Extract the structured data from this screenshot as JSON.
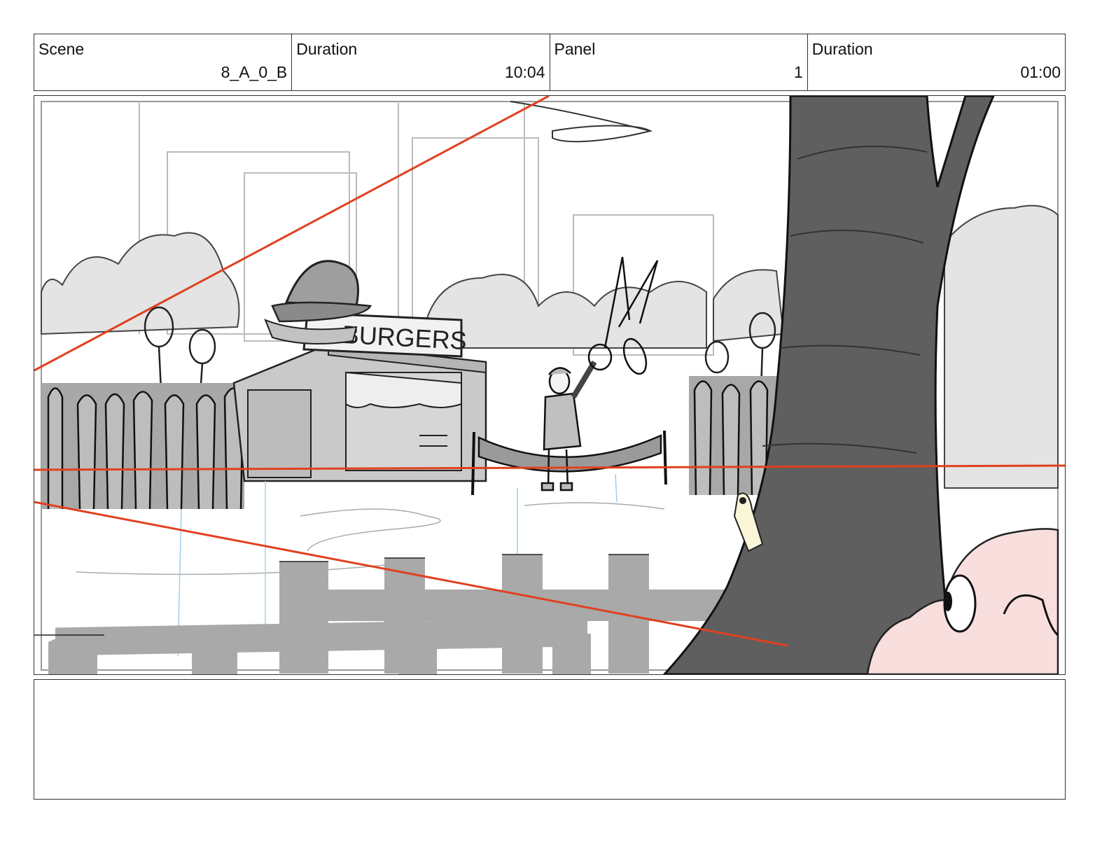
{
  "header": {
    "scene_label": "Scene",
    "scene_value": "8_A_0_B",
    "scene_duration_label": "Duration",
    "scene_duration_value": "10:04",
    "panel_label": "Panel",
    "panel_value": "1",
    "panel_duration_label": "Duration",
    "panel_duration_value": "01:00"
  },
  "panel": {
    "sign_text": "BURGERS"
  },
  "notes": {
    "text": ""
  },
  "colors": {
    "perspective_line": "#e0401f",
    "tree_trunk": "#5f5f5f",
    "crowd": "#a8a8a8",
    "character_pink": "#f9dede"
  }
}
